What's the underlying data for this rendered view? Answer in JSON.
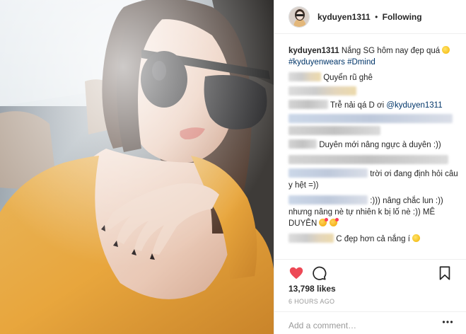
{
  "header": {
    "username": "kyduyen1311",
    "separator": "•",
    "follow_status": "Following",
    "avatar_icon": "profile-avatar-icon"
  },
  "caption": {
    "username": "kyduyen1311",
    "text": "Nắng SG hôm nay đẹp quá",
    "hashtags": [
      "#kyduyenwears",
      "#Dmind"
    ]
  },
  "comments": [
    {
      "text": "Quyển rũ ghê"
    },
    {
      "text": "Trễ nải qá D ơi",
      "mention": "@kyduyen1311"
    },
    {
      "text": "Duyên mới nâng ngực à duyên :))"
    },
    {
      "text": "trời ơi đang định hỏi câu y hệt =))"
    },
    {
      "text": ":))) nâng chắc lun :)) nhưng nâng nè tự nhiên k bị lố nè :)) MÊ DUYÊN"
    },
    {
      "text": "C đẹp hơn cả nắng í"
    }
  ],
  "actions": {
    "like_icon": "heart-filled-icon",
    "comment_icon": "comment-bubble-icon",
    "save_icon": "bookmark-icon",
    "like_color": "#ed4956"
  },
  "likes": "13,798 likes",
  "timestamp": "6 HOURS AGO",
  "add_comment": {
    "placeholder": "Add a comment…",
    "more_icon": "more-options-icon"
  }
}
